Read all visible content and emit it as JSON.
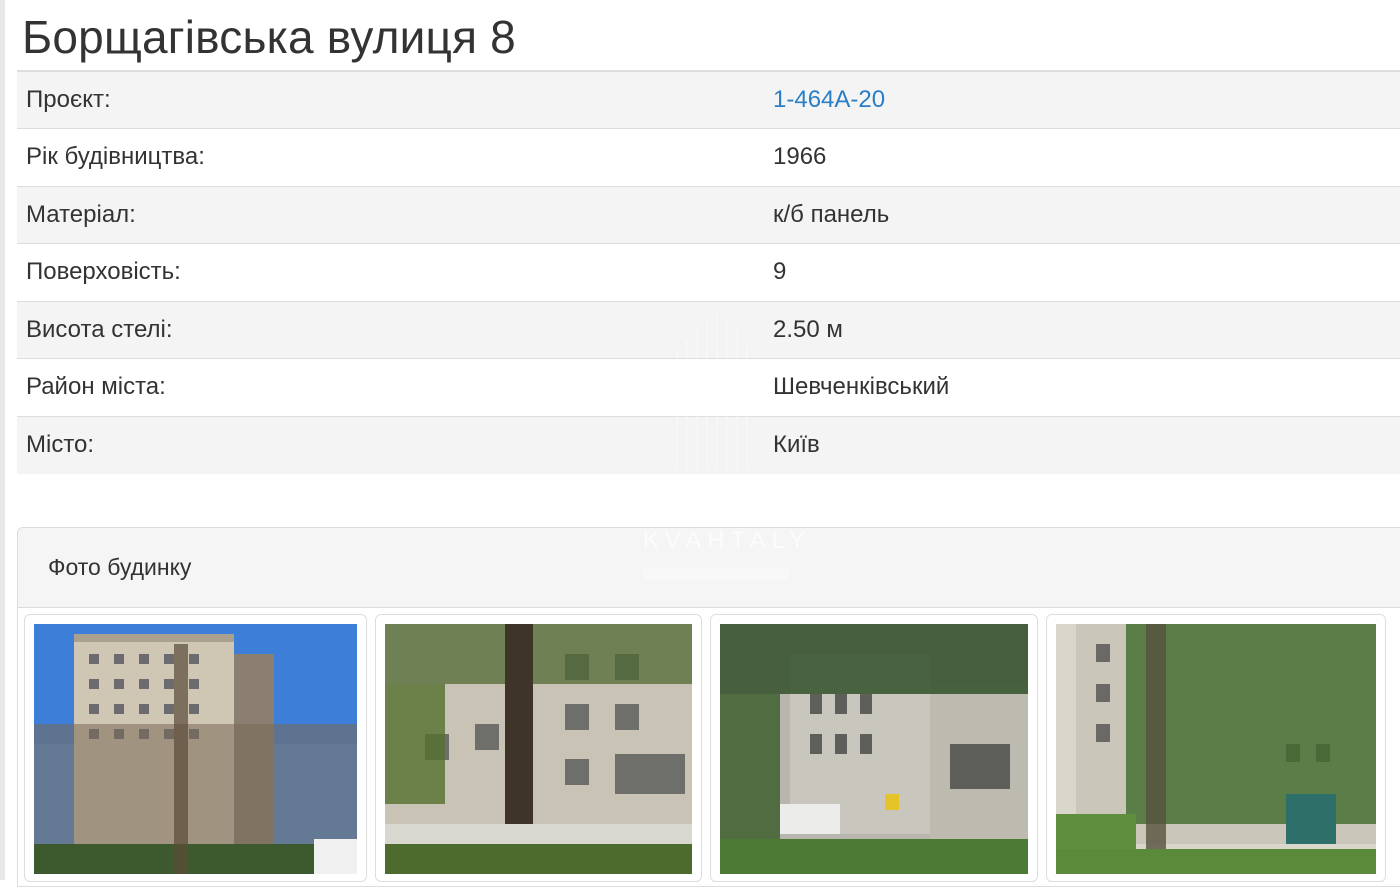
{
  "page": {
    "title": "Борщагівська вулиця 8"
  },
  "details": [
    {
      "label": "Проєкт:",
      "value": "1-464А-20",
      "is_link": true
    },
    {
      "label": "Рік будівництва:",
      "value": "1966",
      "is_link": false
    },
    {
      "label": "Матеріал:",
      "value": "к/б панель",
      "is_link": false
    },
    {
      "label": "Поверховість:",
      "value": "9",
      "is_link": false
    },
    {
      "label": "Висота стелі:",
      "value": "2.50 м",
      "is_link": false
    },
    {
      "label": "Район міста:",
      "value": "Шевченківський",
      "is_link": false
    },
    {
      "label": "Місто:",
      "value": "Київ",
      "is_link": false
    }
  ],
  "photos_panel": {
    "heading": "Фото будинку",
    "photos": [
      "building-photo-1",
      "building-photo-2",
      "building-photo-3",
      "building-photo-4"
    ]
  },
  "watermark": {
    "text": "KVAHTALY"
  },
  "colors": {
    "link": "#2a7ec6",
    "stripe": "#f4f4f4",
    "border": "#dddddd",
    "text": "#333333"
  }
}
